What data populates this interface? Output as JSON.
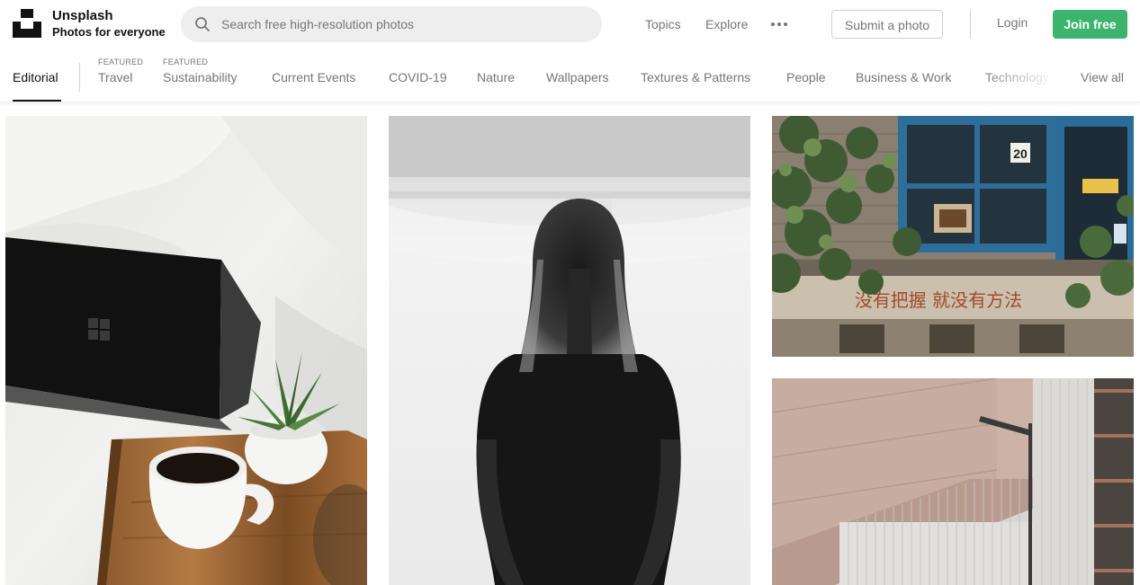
{
  "header": {
    "brand_name": "Unsplash",
    "brand_tagline": "Photos for everyone",
    "search_placeholder": "Search free high-resolution photos",
    "nav": {
      "topics": "Topics",
      "explore": "Explore"
    },
    "submit_label": "Submit a photo",
    "login_label": "Login",
    "join_label": "Join free"
  },
  "topics": {
    "editorial": "Editorial",
    "featured_label": "FEATURED",
    "items": [
      "Travel",
      "Sustainability",
      "Current Events",
      "COVID-19",
      "Nature",
      "Wallpapers",
      "Textures & Patterns",
      "People",
      "Business & Work",
      "Technology"
    ],
    "view_all": "View all",
    "active": "Editorial"
  },
  "photos": {
    "storefront_sign_number": "20",
    "storefront_wall_text": "没有把握 就没有方法"
  },
  "colors": {
    "accent_green": "#3cb46e",
    "text_primary": "#111111",
    "text_secondary": "#767676",
    "search_bg": "#eeeeee"
  },
  "icons": {
    "logo": "unsplash-logo-icon",
    "search": "search-icon",
    "more": "more-horizontal-icon"
  }
}
